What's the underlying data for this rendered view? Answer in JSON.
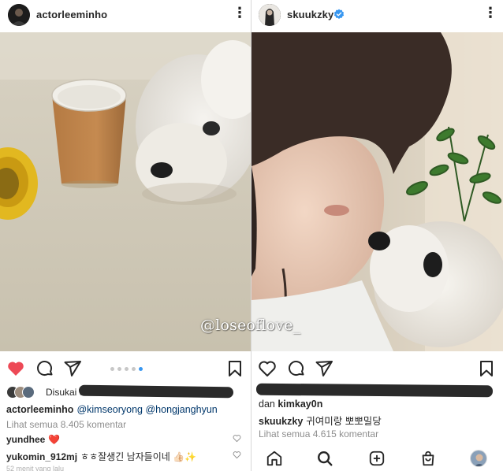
{
  "left_post": {
    "username": "actorleeminho",
    "likes_text": "Disukai oleh",
    "caption": {
      "username": "actorleeminho",
      "mentions": [
        "@kimseoryong",
        "@hongjanghyun"
      ]
    },
    "view_all": "Lihat semua 8.405 komentar",
    "comments": [
      {
        "username": "yundhee",
        "text": "❤️"
      },
      {
        "username": "yukomin_912mj",
        "text": "ㅎㅎ잘생긴 남자들이네 👍🏻✨"
      }
    ],
    "time": "52 menit yang lalu",
    "carousel": {
      "count": 5,
      "active_index": 4
    },
    "liked": true,
    "colors": {
      "like_red": "#ed4956",
      "dot_active": "#3897f0"
    }
  },
  "right_post": {
    "username": "skuukzky",
    "verified": true,
    "likes_prefix": "dan",
    "likes_user": "kimkay0n",
    "caption": {
      "username": "skuukzky",
      "text": "귀여미랑 뽀뽀밀당"
    },
    "view_all": "Lihat semua 4.615 komentar",
    "liked": false,
    "colors": {
      "verified_blue": "#3897f0"
    }
  },
  "watermark": "@loseoflove_",
  "icons": {
    "left_actions": [
      "heart-filled-icon",
      "comment-icon",
      "share-icon",
      "bookmark-icon"
    ],
    "right_actions": [
      "heart-icon",
      "comment-icon",
      "share-icon",
      "bookmark-icon"
    ],
    "nav": [
      "home-icon",
      "search-icon",
      "new-post-icon",
      "shop-icon",
      "profile-avatar"
    ]
  }
}
